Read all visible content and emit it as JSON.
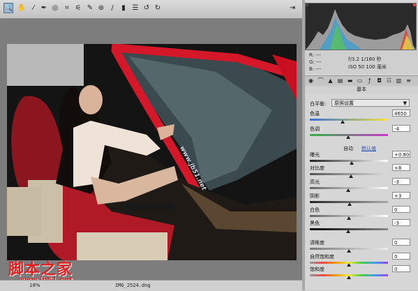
{
  "toolbar": {
    "tools": [
      "zoom-tool-icon",
      "hand-tool-icon",
      "white-balance-icon",
      "color-sampler-icon",
      "target-adjust-icon",
      "crop-icon",
      "straighten-icon",
      "spot-removal-icon",
      "red-eye-icon",
      "adjustment-brush-icon",
      "graduated-filter-icon",
      "preferences-icon",
      "rotate-left-icon",
      "rotate-right-icon"
    ],
    "exit_icon": "exit-icon"
  },
  "status": {
    "zoom": "18%",
    "filename": "IMG_2524.dng"
  },
  "readout": {
    "r": "R:  ---",
    "g": "G:  ---",
    "b": "B:  ---",
    "aperture_shutter": "f/3.2   1/160 秒",
    "iso_focal": "ISO 50   100 毫米"
  },
  "panel": {
    "section_title": "基本",
    "white_balance_label": "白平衡:",
    "white_balance_value": "原照设置",
    "auto_label": "自动",
    "default_label": "默认值",
    "sliders": [
      {
        "label": "色温",
        "value": "4650",
        "pos": 0.42
      },
      {
        "label": "色调",
        "value": "-4",
        "pos": 0.49
      },
      {
        "label": "曝光",
        "value": "+0.80",
        "pos": 0.54
      },
      {
        "label": "对比度",
        "value": "+8",
        "pos": 0.53
      },
      {
        "label": "高光",
        "value": "-3",
        "pos": 0.49
      },
      {
        "label": "阴影",
        "value": "+3",
        "pos": 0.51
      },
      {
        "label": "白色",
        "value": "0",
        "pos": 0.5
      },
      {
        "label": "黑色",
        "value": "-3",
        "pos": 0.49
      },
      {
        "label": "清晰度",
        "value": "0",
        "pos": 0.5
      },
      {
        "label": "自然饱和度",
        "value": "0",
        "pos": 0.5
      },
      {
        "label": "饱和度",
        "value": "0",
        "pos": 0.5
      }
    ]
  },
  "watermark": {
    "site": "www.jb51.net",
    "logo_cn": "脚本之家",
    "logo_url": "www.jb51.net"
  },
  "colors": {
    "accent": "#4e6e94",
    "histogram_bg": "#2a2a2a",
    "logo_red": "#e02020"
  }
}
